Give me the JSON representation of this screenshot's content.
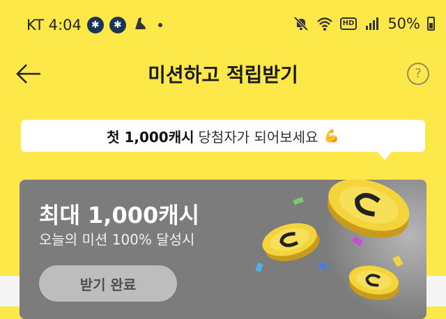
{
  "status_bar": {
    "carrier_time": "KT 4:04",
    "battery": "50%",
    "hd_label": "HD",
    "icons": [
      "bluetooth-icon",
      "bluetooth-icon",
      "shoe-icon",
      "mute-icon",
      "wifi-icon",
      "hd-icon",
      "signal-icon",
      "battery-icon"
    ]
  },
  "header": {
    "title": "미션하고 적립받기",
    "help": "?"
  },
  "banner": {
    "bold": "첫 1,000캐시",
    "text": "당첨자가 되어보세요",
    "emoji": "💪"
  },
  "card": {
    "title": "최대 1,000캐시",
    "subtitle": "오늘의 미션 100% 달성시",
    "button": "받기 완료"
  },
  "colors": {
    "background": "#fde84a",
    "card": "#7c7c7c",
    "button": "#bdbdbd",
    "coin": "#f3d43a"
  }
}
